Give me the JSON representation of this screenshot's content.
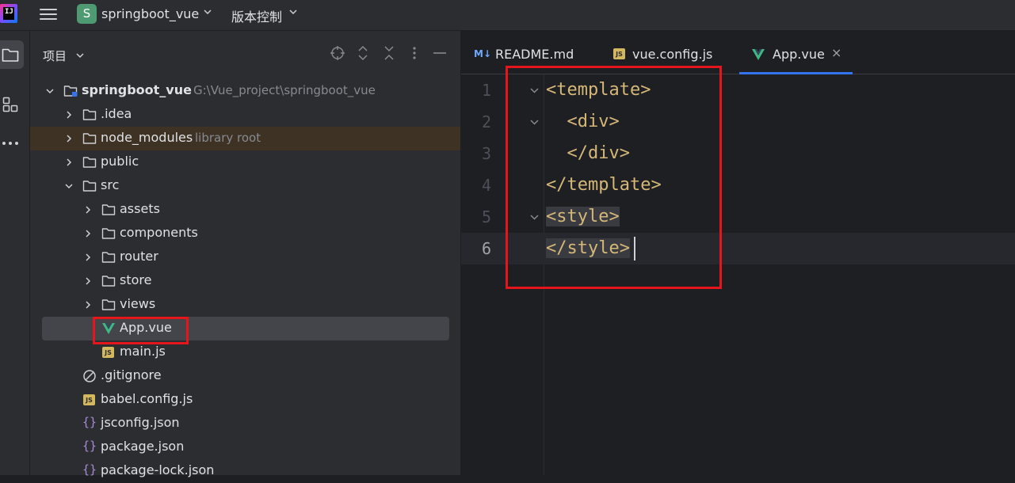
{
  "titlebar": {
    "project_badge": "S",
    "project_name": "springboot_vue",
    "vcs_label": "版本控制",
    "app_logo_text": "IJ"
  },
  "toolstrip": {
    "icons": [
      "folder-icon",
      "structure-icon",
      "more-icon"
    ]
  },
  "project_panel": {
    "title": "项目",
    "actions": [
      "locate-icon",
      "expand-all-icon",
      "collapse-all-icon",
      "options-icon",
      "hide-icon"
    ],
    "tree": [
      {
        "label": "springboot_vue",
        "hint": "G:\\Vue_project\\springboot_vue",
        "icon": "folder-icon",
        "expanded": true
      },
      {
        "label": ".idea",
        "icon": "folder-icon",
        "expanded": false
      },
      {
        "label": "node_modules",
        "hint": "library root",
        "icon": "folder-icon",
        "expanded": false
      },
      {
        "label": "public",
        "icon": "folder-icon",
        "expanded": false
      },
      {
        "label": "src",
        "icon": "folder-icon",
        "expanded": true
      },
      {
        "label": "assets",
        "icon": "folder-icon",
        "expanded": false
      },
      {
        "label": "components",
        "icon": "folder-icon",
        "expanded": false
      },
      {
        "label": "router",
        "icon": "folder-icon",
        "expanded": false
      },
      {
        "label": "store",
        "icon": "folder-icon",
        "expanded": false
      },
      {
        "label": "views",
        "icon": "folder-icon",
        "expanded": false
      },
      {
        "label": "App.vue",
        "icon": "vue-icon",
        "selected": true
      },
      {
        "label": "main.js",
        "icon": "js-icon",
        "badge": "JS"
      },
      {
        "label": ".gitignore",
        "icon": "ignore-icon"
      },
      {
        "label": "babel.config.js",
        "icon": "js-icon",
        "badge": "JS"
      },
      {
        "label": "jsconfig.json",
        "icon": "json-icon",
        "badge": "{}"
      },
      {
        "label": "package.json",
        "icon": "json-icon",
        "badge": "{}"
      },
      {
        "label": "package-lock.json",
        "icon": "json-icon",
        "badge": "{}"
      }
    ]
  },
  "editor": {
    "tabs": [
      {
        "label": "README.md",
        "badge": "M↓",
        "active": false
      },
      {
        "label": "vue.config.js",
        "badge": "JS",
        "active": false
      },
      {
        "label": "App.vue",
        "active": true,
        "close": "×"
      }
    ],
    "lines": [
      {
        "num": "1",
        "text": "<template>"
      },
      {
        "num": "2",
        "text": "  <div>"
      },
      {
        "num": "3",
        "text": "  </div>"
      },
      {
        "num": "4",
        "text": "</template>"
      },
      {
        "num": "5",
        "text": "<style>"
      },
      {
        "num": "6",
        "text": "</style>"
      }
    ]
  },
  "colors": {
    "accent": "#3574f0",
    "annotation": "#e4161c",
    "code_tag": "#d5b778",
    "vue_green": "#41b883"
  }
}
